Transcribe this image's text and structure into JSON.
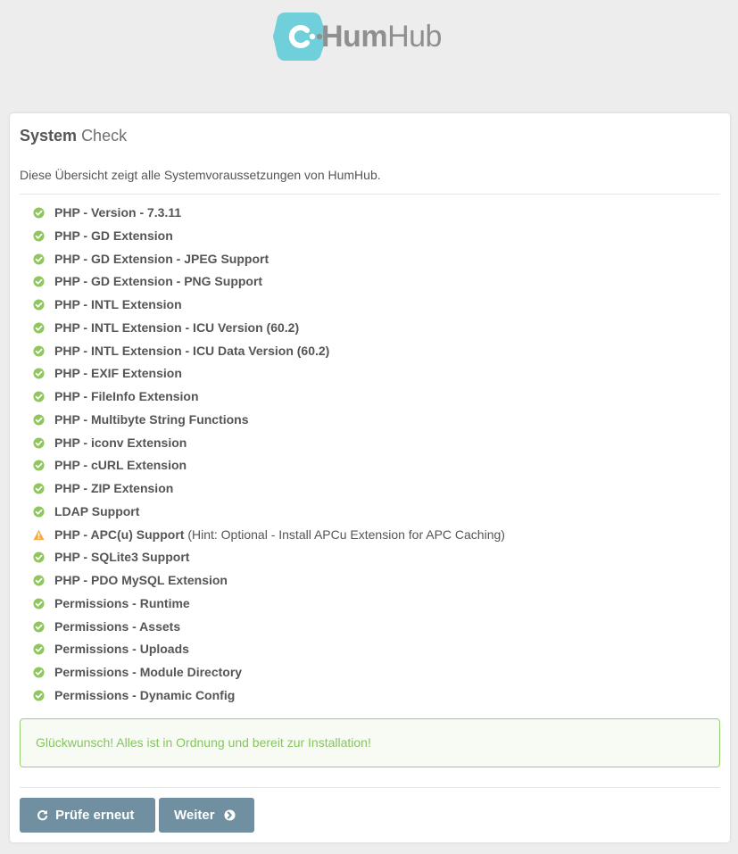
{
  "brand": {
    "name_bold": "Hum",
    "name_light": "Hub",
    "logo_color": "#6fcfda"
  },
  "panel": {
    "title_strong": "System",
    "title_light": "Check",
    "intro": "Diese Übersicht zeigt alle Systemvoraussetzungen von HumHub."
  },
  "checks": [
    {
      "label": "PHP - Version - 7.3.11",
      "hint": "",
      "status": "ok"
    },
    {
      "label": "PHP - GD Extension",
      "hint": "",
      "status": "ok"
    },
    {
      "label": "PHP - GD Extension - JPEG Support",
      "hint": "",
      "status": "ok"
    },
    {
      "label": "PHP - GD Extension - PNG Support",
      "hint": "",
      "status": "ok"
    },
    {
      "label": "PHP - INTL Extension",
      "hint": "",
      "status": "ok"
    },
    {
      "label": "PHP - INTL Extension - ICU Version (60.2)",
      "hint": "",
      "status": "ok"
    },
    {
      "label": "PHP - INTL Extension - ICU Data Version (60.2)",
      "hint": "",
      "status": "ok"
    },
    {
      "label": "PHP - EXIF Extension",
      "hint": "",
      "status": "ok"
    },
    {
      "label": "PHP - FileInfo Extension",
      "hint": "",
      "status": "ok"
    },
    {
      "label": "PHP - Multibyte String Functions",
      "hint": "",
      "status": "ok"
    },
    {
      "label": "PHP - iconv Extension",
      "hint": "",
      "status": "ok"
    },
    {
      "label": "PHP - cURL Extension",
      "hint": "",
      "status": "ok"
    },
    {
      "label": "PHP - ZIP Extension",
      "hint": "",
      "status": "ok"
    },
    {
      "label": "LDAP Support",
      "hint": "",
      "status": "ok"
    },
    {
      "label": "PHP - APC(u) Support",
      "hint": "(Hint: Optional - Install APCu Extension for APC Caching)",
      "status": "warning"
    },
    {
      "label": "PHP - SQLite3 Support",
      "hint": "",
      "status": "ok"
    },
    {
      "label": "PHP - PDO MySQL Extension",
      "hint": "",
      "status": "ok"
    },
    {
      "label": "Permissions - Runtime",
      "hint": "",
      "status": "ok"
    },
    {
      "label": "Permissions - Assets",
      "hint": "",
      "status": "ok"
    },
    {
      "label": "Permissions - Uploads",
      "hint": "",
      "status": "ok"
    },
    {
      "label": "Permissions - Module Directory",
      "hint": "",
      "status": "ok"
    },
    {
      "label": "Permissions - Dynamic Config",
      "hint": "",
      "status": "ok"
    }
  ],
  "alert": {
    "message": "Glückwunsch! Alles ist in Ordnung und bereit zur Installation!"
  },
  "buttons": {
    "recheck_label": "Prüfe erneut",
    "recheck_icon": "refresh-icon",
    "next_label": "Weiter",
    "next_icon": "arrow-circle-right-icon"
  },
  "colors": {
    "ok": "#8fc65e",
    "warning": "#f0ad4e",
    "button": "#708fa0",
    "alert_text": "#86c55f",
    "alert_border": "#97d271"
  }
}
